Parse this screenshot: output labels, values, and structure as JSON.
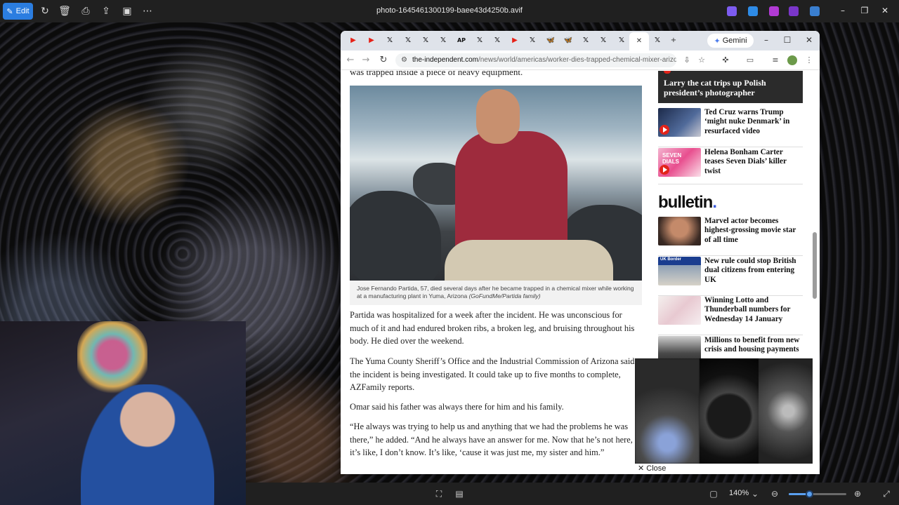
{
  "viewer": {
    "edit_label": "Edit",
    "file_name": "photo-1645461300199-baee43d4250b.avif",
    "zoom": "140%",
    "zoom_fraction": 0.35
  },
  "browser": {
    "gemini_label": "Gemini",
    "url_domain": "the-independent.com",
    "url_path": "/news/world/americas/worker-dies-trapped-chemical-mixer-arizon..."
  },
  "article": {
    "prev_line": "was trapped inside a piece of heavy equipment.",
    "caption": "Jose Fernando Partida, 57, died several days after he became trapped in a chemical mixer while working at a manufacturing plant in Yuma, Arizona",
    "caption_credit": "(GoFundMe/Partida family)",
    "paragraphs": [
      "Partida was hospitalized for a week after the incident. He was unconscious for much of it and had endured broken ribs, a broken leg, and bruising throughout his body. He died over the weekend.",
      "The Yuma County Sheriff’s Office and the Industrial Commission of Arizona said the incident is being investigated. It could take up to five months to complete, AZFamily reports.",
      "Omar said his father was always there for him and his family.",
      "“He always was trying to help us and anything that we had the problems he was there,” he added. “And he always have an answer for me. Now that he’s not here, it’s like, I don’t know. It’s like, ‘cause it was just me, my sister and him.”"
    ]
  },
  "sidebar": {
    "dark_card": "Larry the cat trips up Polish president’s photographer",
    "items_top": [
      "Ted Cruz warns Trump ‘might nuke Denmark’ in resurfaced video",
      "Helena Bonham Carter teases Seven Dials’ killer twist"
    ],
    "bulletin_word": "bulletin",
    "bulletin_dot": ".",
    "items_bulletin": [
      "Marvel actor becomes highest-grossing movie star of all time",
      "New rule could stop British dual citizens from entering UK",
      "Winning Lotto and Thunderball numbers for Wednesday 14 January",
      "Millions to benefit from new crisis and housing payments"
    ],
    "thumb_labels": {
      "uk_border": "UK Border",
      "seven_dials": "SEVEN DIALS"
    }
  },
  "video": {
    "close_label": "Close"
  },
  "colors": {
    "accent": "#2b7de0",
    "independent_red": "#e2231a",
    "bulletin_blue": "#3b5bdb"
  }
}
